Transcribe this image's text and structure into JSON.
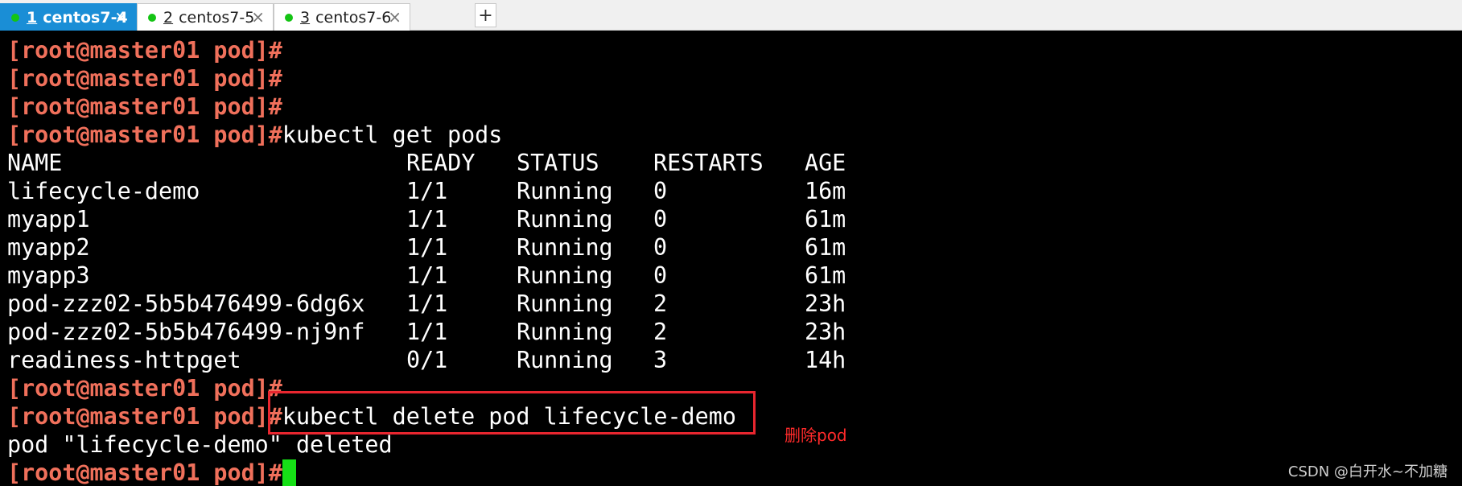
{
  "tabs": [
    {
      "number": "1",
      "title": "centos7-4",
      "active": true,
      "close": "×"
    },
    {
      "number": "2",
      "title": "centos7-5",
      "active": false,
      "close": "×"
    },
    {
      "number": "3",
      "title": "centos7-6",
      "active": false,
      "close": "×"
    }
  ],
  "add_tab_label": "+",
  "prompt": "[root@master01 pod]#",
  "commands": {
    "get_pods": "kubectl get pods",
    "delete_pod": "kubectl delete pod lifecycle-demo"
  },
  "table": {
    "headers": [
      "NAME",
      "READY",
      "STATUS",
      "RESTARTS",
      "AGE"
    ],
    "rows": [
      [
        "lifecycle-demo",
        "1/1",
        "Running",
        "0",
        "16m"
      ],
      [
        "myapp1",
        "1/1",
        "Running",
        "0",
        "61m"
      ],
      [
        "myapp2",
        "1/1",
        "Running",
        "0",
        "61m"
      ],
      [
        "myapp3",
        "1/1",
        "Running",
        "0",
        "61m"
      ],
      [
        "pod-zzz02-5b5b476499-6dg6x",
        "1/1",
        "Running",
        "2",
        "23h"
      ],
      [
        "pod-zzz02-5b5b476499-nj9nf",
        "1/1",
        "Running",
        "2",
        "23h"
      ],
      [
        "readiness-httpget",
        "0/1",
        "Running",
        "3",
        "14h"
      ]
    ]
  },
  "delete_output": "pod \"lifecycle-demo\" deleted",
  "annotation": "删除pod",
  "watermark": "CSDN @白开水~不加糖",
  "colors": {
    "prompt": "#f0705b",
    "active_tab": "#1a8ed6",
    "status_dot": "#14c414",
    "cursor": "#16e016",
    "highlight": "#e8262f"
  }
}
